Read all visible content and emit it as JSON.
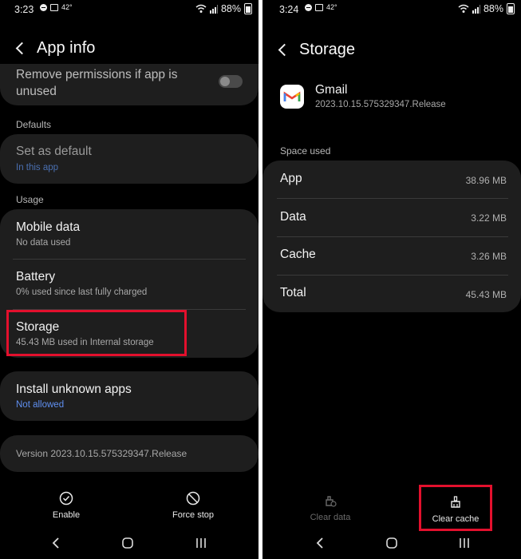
{
  "left": {
    "status": {
      "time": "3:23",
      "temp": "42°",
      "battery": "88%"
    },
    "title": "App info",
    "permissions": {
      "label": "Remove permissions if app is unused"
    },
    "defaults_header": "Defaults",
    "set_default": {
      "title": "Set as default",
      "subtitle": "In this app"
    },
    "usage_header": "Usage",
    "usage_items": [
      {
        "title": "Mobile data",
        "subtitle": "No data used"
      },
      {
        "title": "Battery",
        "subtitle": "0% used since last fully charged"
      },
      {
        "title": "Storage",
        "subtitle": "45.43 MB used in Internal storage"
      }
    ],
    "unknown_apps": {
      "title": "Install unknown apps",
      "subtitle": "Not allowed"
    },
    "version": "Version 2023.10.15.575329347.Release",
    "actions": {
      "enable": "Enable",
      "force_stop": "Force stop"
    }
  },
  "right": {
    "status": {
      "time": "3:24",
      "temp": "42°",
      "battery": "88%"
    },
    "title": "Storage",
    "app": {
      "name": "Gmail",
      "version": "2023.10.15.575329347.Release"
    },
    "space_header": "Space used",
    "space_rows": [
      {
        "label": "App",
        "value": "38.96 MB"
      },
      {
        "label": "Data",
        "value": "3.22 MB"
      },
      {
        "label": "Cache",
        "value": "3.26 MB"
      },
      {
        "label": "Total",
        "value": "45.43 MB"
      }
    ],
    "actions": {
      "clear_data": "Clear data",
      "clear_cache": "Clear cache"
    }
  },
  "colors": {
    "highlight": "#e3102d",
    "link": "#5f8ff0",
    "card": "#1e1e1e"
  }
}
